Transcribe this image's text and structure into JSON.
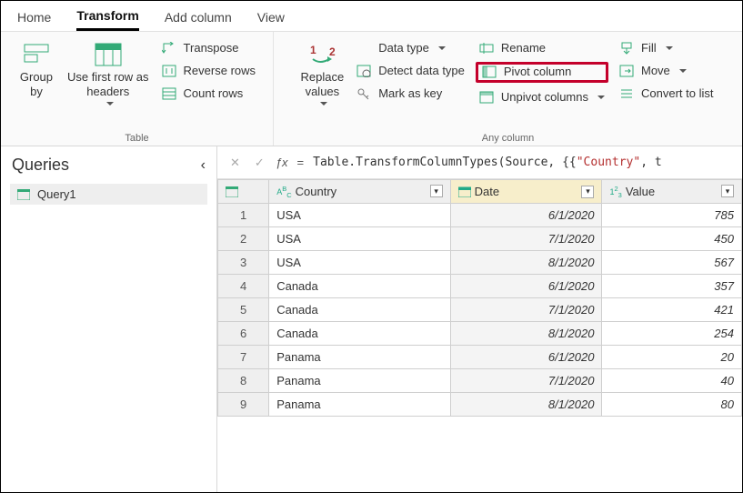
{
  "tabs": [
    "Home",
    "Transform",
    "Add column",
    "View"
  ],
  "active_tab": "Transform",
  "ribbon": {
    "table_group": {
      "label": "Table",
      "group_by": "Group\nby",
      "use_first_row": "Use first row as\nheaders",
      "transpose": "Transpose",
      "reverse_rows": "Reverse rows",
      "count_rows": "Count rows"
    },
    "any_column_group": {
      "label": "Any column",
      "replace_values": "Replace\nvalues",
      "data_type": "Data type",
      "detect_data_type": "Detect data type",
      "mark_as_key": "Mark as key",
      "rename": "Rename",
      "pivot_column": "Pivot column",
      "unpivot_columns": "Unpivot columns",
      "fill": "Fill",
      "move": "Move",
      "convert_to_list": "Convert to list"
    }
  },
  "queries": {
    "title": "Queries",
    "items": [
      "Query1"
    ]
  },
  "formula_bar": {
    "prefix": "Table.TransformColumnTypes(Source, {{",
    "string_literal": "\"Country\"",
    "suffix": ", t"
  },
  "grid": {
    "columns": [
      {
        "name": "Country",
        "type": "ABC",
        "selected": false
      },
      {
        "name": "Date",
        "type": "cal",
        "selected": true
      },
      {
        "name": "Value",
        "type": "123",
        "selected": false
      }
    ],
    "rows": [
      {
        "n": 1,
        "country": "USA",
        "date": "6/1/2020",
        "value": "785"
      },
      {
        "n": 2,
        "country": "USA",
        "date": "7/1/2020",
        "value": "450"
      },
      {
        "n": 3,
        "country": "USA",
        "date": "8/1/2020",
        "value": "567"
      },
      {
        "n": 4,
        "country": "Canada",
        "date": "6/1/2020",
        "value": "357"
      },
      {
        "n": 5,
        "country": "Canada",
        "date": "7/1/2020",
        "value": "421"
      },
      {
        "n": 6,
        "country": "Canada",
        "date": "8/1/2020",
        "value": "254"
      },
      {
        "n": 7,
        "country": "Panama",
        "date": "6/1/2020",
        "value": "20"
      },
      {
        "n": 8,
        "country": "Panama",
        "date": "7/1/2020",
        "value": "40"
      },
      {
        "n": 9,
        "country": "Panama",
        "date": "8/1/2020",
        "value": "80"
      }
    ]
  }
}
